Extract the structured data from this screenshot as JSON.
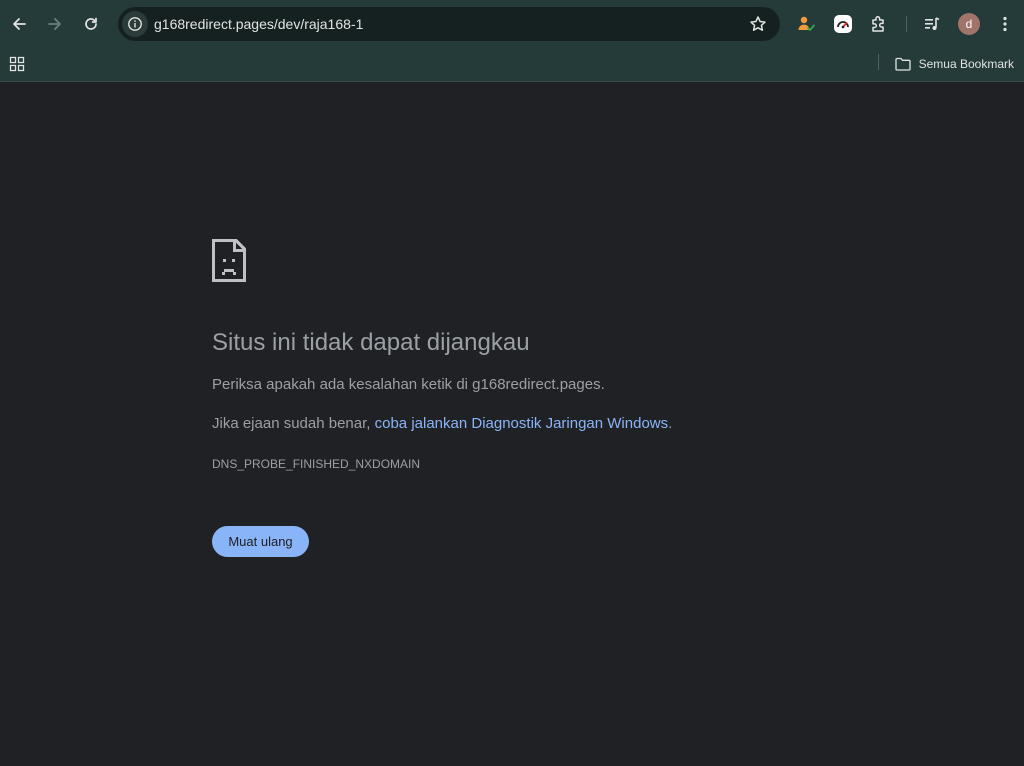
{
  "browser": {
    "url": "g168redirect.pages/dev/raja168-1",
    "profile_initial": "d",
    "bookmarks_label": "Semua Bookmark",
    "icons": {
      "back": "arrow-left",
      "forward": "arrow-right",
      "reload": "refresh",
      "site_info": "info-circle",
      "bookmark": "star",
      "extension_person": "person-check",
      "extension_gauge": "speed-gauge",
      "extensions": "puzzle-piece",
      "media": "media-queue",
      "menu": "kebab-vertical",
      "apps": "grid-apps",
      "folder": "folder"
    }
  },
  "error_page": {
    "title": "Situs ini tidak dapat dijangkau",
    "check_text": "Periksa apakah ada kesalahan ketik di g168redirect.pages.",
    "hint_prefix": "Jika ejaan sudah benar, ",
    "hint_link": "coba jalankan Diagnostik Jaringan Windows",
    "hint_suffix": ".",
    "error_code": "DNS_PROBE_FINISHED_NXDOMAIN",
    "reload_label": "Muat ulang"
  },
  "colors": {
    "toolbar_bg": "#243b3a",
    "omnibox_bg": "#152120",
    "page_bg": "#202124",
    "text_muted": "#9aa0a6",
    "link": "#8ab4f8",
    "button_bg": "#8ab4f8"
  }
}
